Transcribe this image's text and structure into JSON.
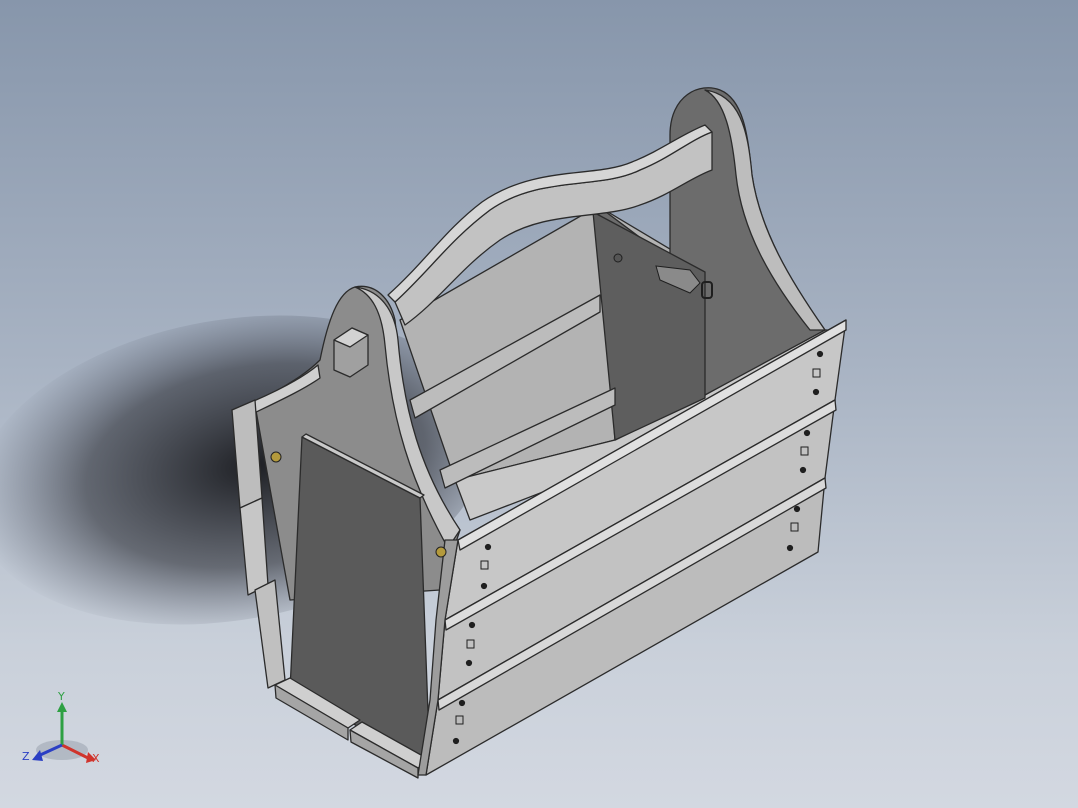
{
  "viewport": {
    "background_top": "#8796ab",
    "background_bottom": "#d3d8e1"
  },
  "model": {
    "face_light": "#c4c4c4",
    "face_mid": "#a9a9a9",
    "face_dark": "#7d7d7d",
    "face_darker": "#5c5c5c",
    "edge_color": "#2b2b2b",
    "shadow_color": "#1e1f24"
  },
  "triad": {
    "x_label": "X",
    "y_label": "Y",
    "z_label": "Z",
    "x_color": "#d0342c",
    "y_color": "#2ea043",
    "z_color": "#2b3fc4",
    "icons": [
      "x-axis-arrow-icon",
      "y-axis-arrow-icon",
      "z-axis-arrow-icon"
    ]
  }
}
